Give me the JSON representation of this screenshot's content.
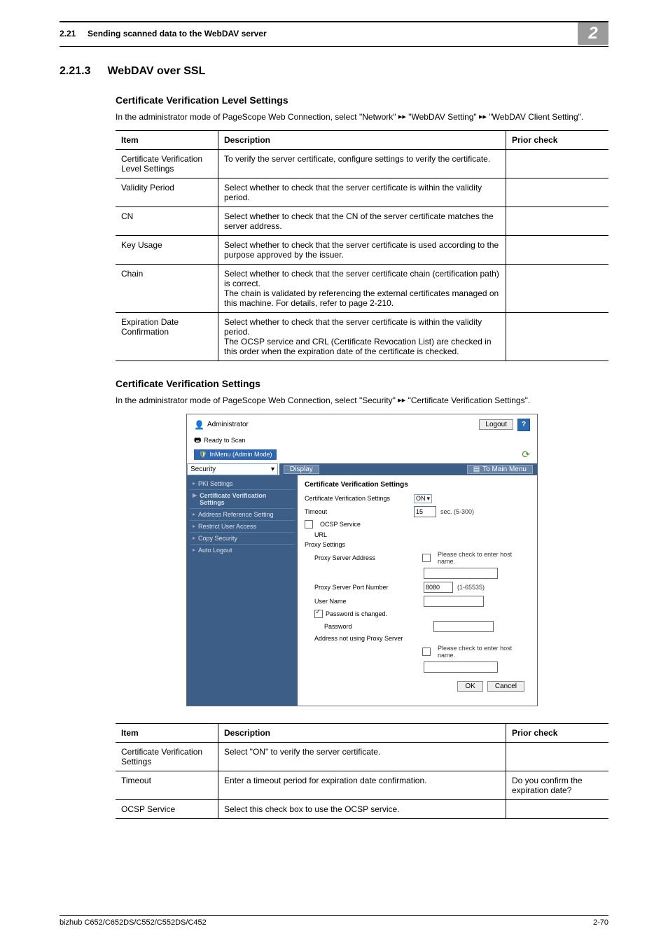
{
  "header": {
    "section_no": "2.21",
    "section_title": "Sending scanned data to the WebDAV server",
    "chapter_badge": "2"
  },
  "h2": {
    "number": "2.21.3",
    "title": "WebDAV over SSL"
  },
  "sec1": {
    "heading": "Certificate Verification Level Settings",
    "intro_1": "In the administrator mode of PageScope Web Connection, select \"Network\" ",
    "intro_2": " \"WebDAV Setting\" ",
    "intro_3": " \"WebDAV Client Setting\"."
  },
  "table1": {
    "headers": [
      "Item",
      "Description",
      "Prior check"
    ],
    "rows": [
      {
        "item": "Certificate Verification Level Settings",
        "desc": "To verify the server certificate, configure settings to verify the certificate.",
        "prior": ""
      },
      {
        "item": "Validity Period",
        "desc": "Select whether to check that the server certificate is within the validity period.",
        "prior": ""
      },
      {
        "item": "CN",
        "desc": "Select whether to check that the CN of the server certificate matches the server address.",
        "prior": ""
      },
      {
        "item": "Key Usage",
        "desc": "Select whether to check that the server certificate is used according to the purpose approved by the issuer.",
        "prior": ""
      },
      {
        "item": "Chain",
        "desc": "Select whether to check that the server certificate chain (certification path) is correct.\nThe chain is validated by referencing the external certificates managed on this machine. For details, refer to page 2-210.",
        "prior": ""
      },
      {
        "item": "Expiration Date Confirmation",
        "desc": "Select whether to check that the server certificate is within the validity period.\nThe OCSP service and CRL (Certificate Revocation List) are checked in this order when the expiration date of the certificate is checked.",
        "prior": ""
      }
    ]
  },
  "sec2": {
    "heading": "Certificate Verification Settings",
    "intro_1": "In the administrator mode of PageScope Web Connection, select \"Security\"",
    "intro_2": "\"Certificate Verification Settings\"."
  },
  "shot": {
    "admin": "Administrator",
    "logout": "Logout",
    "help": "?",
    "status": "Ready to Scan",
    "mode": "InMenu (Admin Mode)",
    "nav_select": "Security",
    "display_btn": "Display",
    "to_main": "To Main Menu",
    "sidebar": [
      "PKI Settings",
      "Certificate Verification Settings",
      "Address Reference Setting",
      "Restrict User Access",
      "Copy Security",
      "Auto Logout"
    ],
    "main_title": "Certificate Verification Settings",
    "row_cvs_label": "Certificate Verification Settings",
    "row_cvs_value": "ON",
    "row_timeout_label": "Timeout",
    "row_timeout_val": "15",
    "row_timeout_range": "sec. (5-300)",
    "row_ocsp_label": "OCSP Service",
    "row_url_label": "URL",
    "row_proxy_heading": "Proxy Settings",
    "row_proxy_addr_label": "Proxy Server Address",
    "row_host_check": "Please check to enter host name.",
    "row_proxy_port_label": "Proxy Server Port Number",
    "row_proxy_port_val": "8080",
    "row_proxy_port_range": "(1-65535)",
    "row_user_label": "User Name",
    "row_pwd_changed": "Password is changed.",
    "row_pwd_label": "Password",
    "row_noproxy_label": "Address not using Proxy Server",
    "ok": "OK",
    "cancel": "Cancel"
  },
  "table2": {
    "headers": [
      "Item",
      "Description",
      "Prior check"
    ],
    "rows": [
      {
        "item": "Certificate Verification Settings",
        "desc": "Select \"ON\" to verify the server certificate.",
        "prior": ""
      },
      {
        "item": "Timeout",
        "desc": "Enter a timeout period for expiration date confirmation.",
        "prior": "Do you confirm the expiration date?"
      },
      {
        "item": "OCSP Service",
        "desc": "Select this check box to use the OCSP service.",
        "prior": ""
      }
    ]
  },
  "footer": {
    "left": "bizhub C652/C652DS/C552/C552DS/C452",
    "right": "2-70"
  }
}
